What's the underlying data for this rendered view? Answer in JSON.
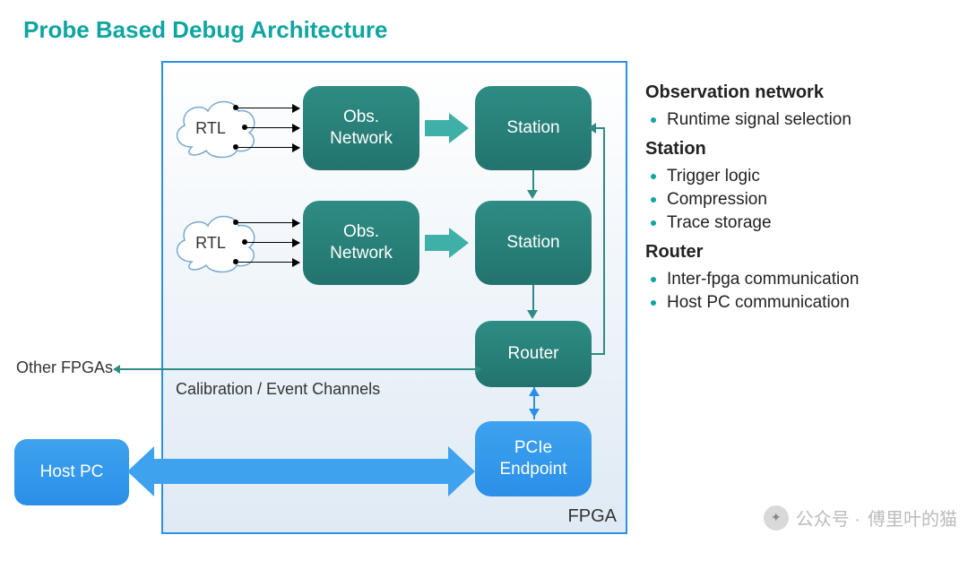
{
  "title": "Probe Based Debug Architecture",
  "fpga_label": "FPGA",
  "nodes": {
    "rtl1": "RTL",
    "rtl2": "RTL",
    "obs1": "Obs.\nNetwork",
    "obs2": "Obs.\nNetwork",
    "station1": "Station",
    "station2": "Station",
    "router": "Router",
    "pcie": "PCIe\nEndpoint",
    "hostpc": "Host PC"
  },
  "labels": {
    "other_fpgas": "Other FPGAs",
    "calibration": "Calibration / Event Channels"
  },
  "legend": {
    "observation": {
      "heading": "Observation network",
      "items": [
        "Runtime signal selection"
      ]
    },
    "station": {
      "heading": "Station",
      "items": [
        "Trigger logic",
        "Compression",
        "Trace storage"
      ]
    },
    "router": {
      "heading": "Router",
      "items": [
        "Inter-fpga communication",
        "Host PC communication"
      ]
    }
  },
  "watermark": {
    "prefix": "公众号 · ",
    "name": "傅里叶的猫"
  }
}
